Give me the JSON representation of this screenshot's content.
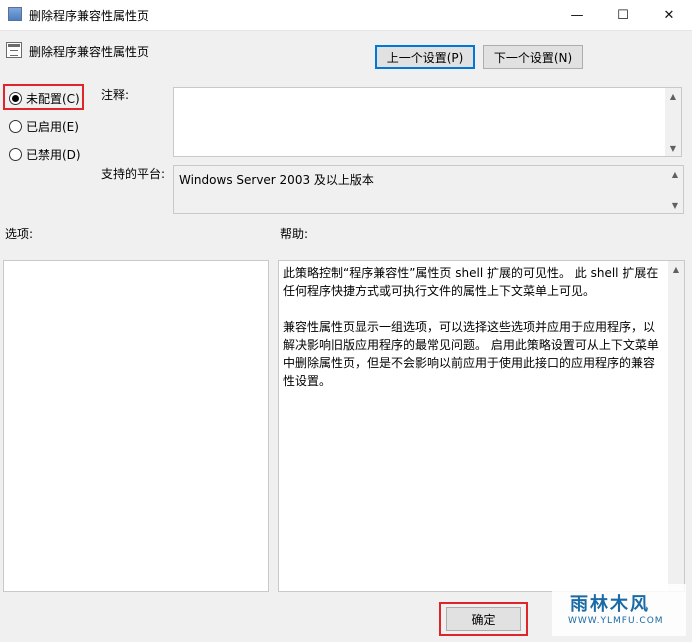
{
  "window": {
    "title": "删除程序兼容性属性页",
    "minimize_glyph": "—",
    "maximize_glyph": "☐",
    "close_glyph": "✕"
  },
  "policy": {
    "name": "删除程序兼容性属性页"
  },
  "nav": {
    "prev_label": "上一个设置(P)",
    "next_label": "下一个设置(N)"
  },
  "state": {
    "options": [
      {
        "label": "未配置(C)",
        "checked": true
      },
      {
        "label": "已启用(E)",
        "checked": false
      },
      {
        "label": "已禁用(D)",
        "checked": false
      }
    ]
  },
  "fields": {
    "comment_label": "注释:",
    "comment_value": "",
    "platform_label": "支持的平台:",
    "platform_value": "Windows Server 2003 及以上版本"
  },
  "panels": {
    "options_label": "选项:",
    "help_label": "帮助:",
    "help_paragraphs": [
      "此策略控制“程序兼容性”属性页 shell 扩展的可见性。 此 shell 扩展在任何程序快捷方式或可执行文件的属性上下文菜单上可见。",
      "兼容性属性页显示一组选项，可以选择这些选项并应用于应用程序，以解决影响旧版应用程序的最常见问题。 启用此策略设置可从上下文菜单中删除属性页，但是不会影响以前应用于使用此接口的应用程序的兼容性设置。"
    ]
  },
  "footer": {
    "ok_label": "确定"
  },
  "watermark": {
    "main": "雨林木风",
    "sub": "WWW.YLMFU.COM"
  }
}
